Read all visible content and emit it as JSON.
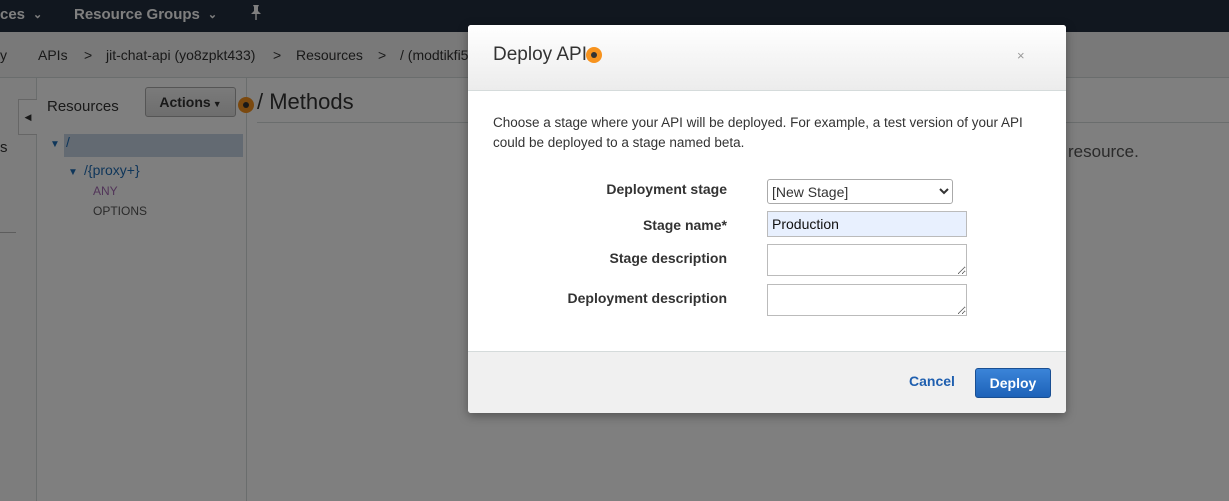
{
  "topnav": {
    "services_label": "ces",
    "resource_groups_label": "Resource Groups"
  },
  "breadcrumb": {
    "prev": "y",
    "apis": "APIs",
    "api_name": "jit-chat-api (yo8zpkt433)",
    "resources": "Resources",
    "path": "/ (modtikfi5",
    "sep": ">"
  },
  "left_panel": {
    "partial_label": "s",
    "collapse_glyph": "◀"
  },
  "resources_panel": {
    "title": "Resources",
    "actions_label": "Actions",
    "tree": {
      "root": "/",
      "child": "/{proxy+}",
      "methods": [
        "ANY",
        "OPTIONS"
      ]
    },
    "colors": {
      "any_method": "#a46ab3",
      "options_method": "#555555",
      "link": "#1f6cb5"
    }
  },
  "main": {
    "title": "/ Methods",
    "partial_text": "resource."
  },
  "modal": {
    "title": "Deploy API",
    "close_glyph": "×",
    "description": "Choose a stage where your API will be deployed. For example, a test version of your API could be deployed to a stage named beta.",
    "fields": {
      "deployment_stage_label": "Deployment stage",
      "deployment_stage_value": "[New Stage]",
      "stage_name_label": "Stage name*",
      "stage_name_value": "Production",
      "stage_description_label": "Stage description",
      "deployment_description_label": "Deployment description"
    },
    "cancel_label": "Cancel",
    "deploy_label": "Deploy"
  },
  "colors": {
    "nav_bg": "#232f3e",
    "hint_orange": "#f7931e",
    "primary_blue": "#1f62b8"
  }
}
